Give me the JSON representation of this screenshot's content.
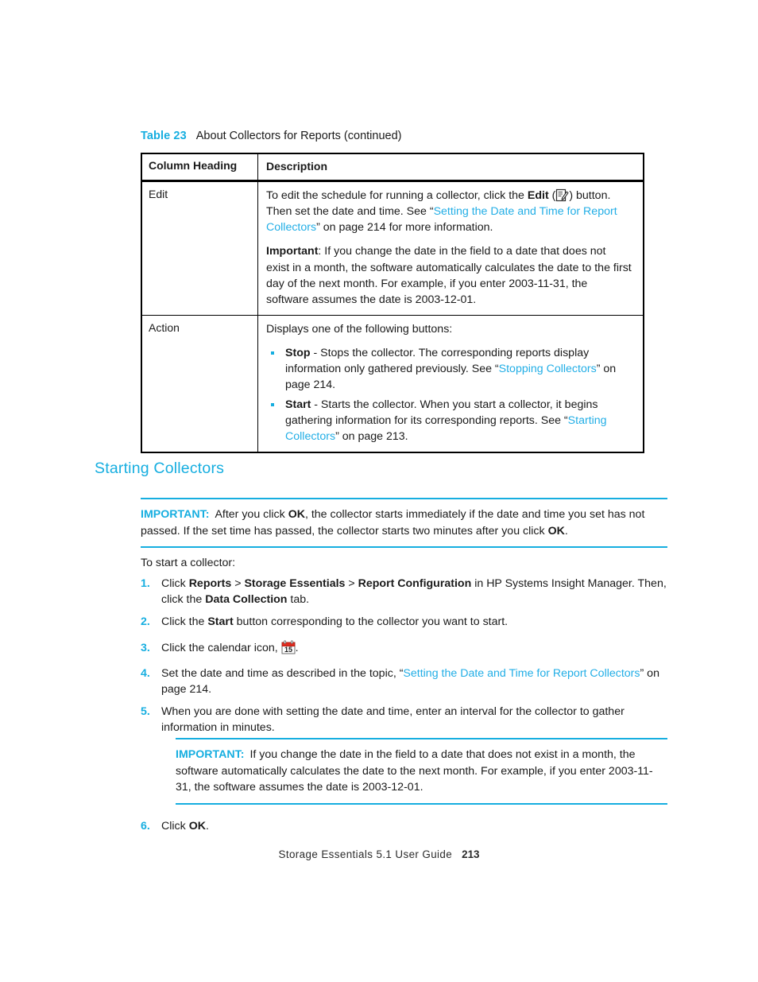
{
  "page": {
    "footer_guide": "Storage Essentials 5.1 User Guide",
    "footer_page": "213"
  },
  "table": {
    "caption_label": "Table 23",
    "caption_text": "About Collectors for Reports (continued)",
    "columns": [
      "Column Heading",
      "Description"
    ],
    "rows": [
      {
        "heading": "Edit",
        "para1_a": "To edit the schedule for running a collector, click the ",
        "para1_bold": "Edit",
        "para1_b": " (",
        "edit_icon": "edit-pencil-icon",
        "para1_c": ") button. Then set the date and time. See “",
        "para1_link": "Setting the Date and Time for Report Collectors",
        "para1_d": "” on page 214 for more information.",
        "para2_bold": "Important",
        "para2_text": ": If you change the date in the field to a date that does not exist in a month, the software automatically calculates the date to the first day of the next month. For example, if you enter 2003-11-31, the software assumes the date is 2003-12-01."
      },
      {
        "heading": "Action",
        "intro": "Displays one of the following buttons:",
        "bullets": [
          {
            "bold": "Stop",
            "text_a": " - Stops the collector. The corresponding reports display information only gathered previously. See “",
            "link": "Stopping Collectors",
            "text_b": "” on page 214."
          },
          {
            "bold": "Start",
            "text_a": " - Starts the collector. When you start a collector, it begins gathering information for its corresponding reports. See “",
            "link": "Starting Collectors",
            "text_b": "” on page 213."
          }
        ]
      }
    ]
  },
  "section": {
    "heading": "Starting Collectors",
    "intro": "To start a collector:"
  },
  "important_1": {
    "label": "IMPORTANT:",
    "text_a": "After you click ",
    "bold_1": "OK",
    "text_b": ", the collector starts immediately if the date and time you set has not passed. If the set time has passed, the collector starts two minutes after you click ",
    "bold_2": "OK",
    "text_c": "."
  },
  "important_2": {
    "label": "IMPORTANT:",
    "text": "If you change the date in the field to a date that does not exist in a month, the software automatically calculates the date to the next month. For example, if you enter 2003-11-31, the software assumes the date is 2003-12-01."
  },
  "steps": [
    {
      "num": "1.",
      "t_a": "Click ",
      "b_1": "Reports",
      "t_b": " > ",
      "b_2": "Storage Essentials",
      "t_c": " > ",
      "b_3": "Report Configuration",
      "t_d": " in  HP Systems Insight Manager. Then, click the ",
      "b_4": "Data Collection",
      "t_e": " tab."
    },
    {
      "num": "2.",
      "t_a": "Click the ",
      "b_1": "Start",
      "t_b": " button corresponding to the collector you want to start."
    },
    {
      "num": "3.",
      "t_a": "Click the calendar icon, ",
      "icon": "calendar-icon",
      "t_b": "."
    },
    {
      "num": "4.",
      "t_a": "Set the date and time as described in the topic, “",
      "link": "Setting the Date and Time for Report Collectors",
      "t_b": "” on page 214."
    },
    {
      "num": "5.",
      "t_a": "When you are done with setting the date and time, enter an interval for the collector to gather information in minutes."
    },
    {
      "num": "6.",
      "t_a": "Click ",
      "b_1": "OK",
      "t_b": "."
    }
  ],
  "colors": {
    "accent": "#16AEE0",
    "link": "#22AEE6",
    "text": "#1a1a1a",
    "calendar_red": "#E02B1E"
  }
}
